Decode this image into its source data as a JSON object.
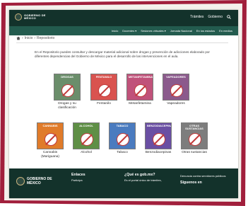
{
  "colors": {
    "frame": "#a11f3c",
    "gov_dark": "#13322b",
    "gov_green": "#235b4e",
    "accent": "#9d2449"
  },
  "header": {
    "logo_text_line1": "GOBIERNO DE",
    "logo_text_line2": "MÉXICO",
    "links": [
      "Trámites",
      "Gobierno"
    ],
    "search_icon": "search-icon"
  },
  "subnav": {
    "items": [
      "Inicio",
      "Docentes",
      "Sesiones virtuales",
      "Jornada Nacional",
      "En los estados",
      "En medios"
    ]
  },
  "breadcrumb": {
    "home_icon": "home-icon",
    "items": [
      "Inicio",
      "Repositorio"
    ]
  },
  "intro": "En el Repositorio puedes consultar y descargar material adicional sobre drogas y prevención de adicciones elaborado por diferentes dependencias del Gobierno de México para el desarrollo de las intervenciones en el aula.",
  "cards_row1": [
    {
      "title": "Drogas",
      "label": "Drogas y su clasificación",
      "color": "#6b8e6b"
    },
    {
      "title": "Fentanilo",
      "label": "Fentanilo",
      "color": "#d9534f"
    },
    {
      "title": "Metanfetamina",
      "label": "Metanfetamina",
      "color": "#c0527a"
    },
    {
      "title": "Vapeadores",
      "label": "Vapeadores",
      "color": "#8b5a8c"
    }
  ],
  "cards_row2": [
    {
      "title": "Cannabis",
      "label": "Cannabis (Mariguana)",
      "color": "#e07b2a"
    },
    {
      "title": "Alcohol",
      "label": "Alcohol",
      "color": "#5f8f46"
    },
    {
      "title": "Tabaco",
      "label": "Tabaco",
      "color": "#4a7bbf"
    },
    {
      "title": "Benzodiacepinas",
      "label": "Benzodiacepinas",
      "color": "#6a4fa3"
    },
    {
      "title": "Otras sustancias",
      "label": "Otras sustancias",
      "color": "#7d7d7d"
    }
  ],
  "footer": {
    "logo_line1": "GOBIERNO DE",
    "logo_line2": "MÉXICO",
    "col1": {
      "heading": "Enlaces",
      "items": [
        "Participa"
      ]
    },
    "col2": {
      "heading": "¿Qué es gob.mx?",
      "items": [
        "Es el portal único de trámites,"
      ]
    },
    "col3": {
      "heading": "",
      "items": [
        "Denuncia contra servidores públicos",
        "Síguenos en"
      ]
    }
  }
}
